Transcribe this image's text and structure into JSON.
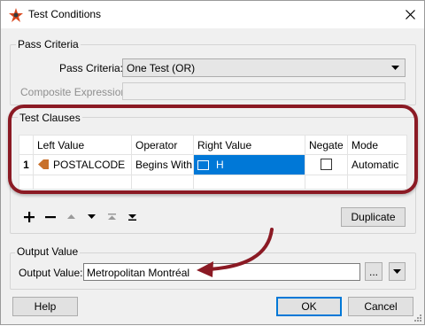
{
  "window": {
    "title": "Test Conditions"
  },
  "pass_criteria": {
    "group_label": "Pass Criteria",
    "field_label": "Pass Criteria:",
    "selected_value": "One Test (OR)",
    "composite_label": "Composite Expression:",
    "composite_value": ""
  },
  "test_clauses": {
    "group_label": "Test Clauses",
    "columns": [
      "Left Value",
      "Operator",
      "Right Value",
      "Negate",
      "Mode"
    ],
    "rows": [
      {
        "index": "1",
        "left_value": "POSTALCODE",
        "operator": "Begins With",
        "right_value": "H",
        "negate": false,
        "mode": "Automatic"
      }
    ],
    "duplicate_label": "Duplicate"
  },
  "output_value": {
    "group_label": "Output Value",
    "field_label": "Output Value:",
    "value": "Metropolitan Montréal",
    "browse_label": "..."
  },
  "footer": {
    "help_label": "Help",
    "ok_label": "OK",
    "cancel_label": "Cancel"
  },
  "colors": {
    "accent": "#0078d7",
    "annotation": "#8b1a24",
    "attribute_icon": "#c8702a"
  }
}
